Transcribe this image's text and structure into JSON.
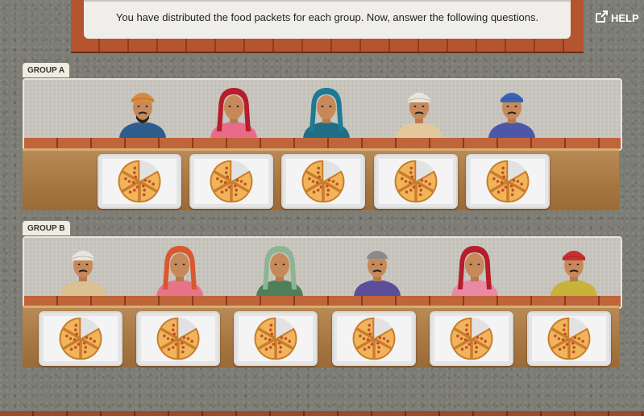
{
  "instruction": "You have distributed the food packets for each group. Now, answer the following questions.",
  "help_label": "HELP",
  "groups": [
    {
      "label": "GROUP A",
      "people": [
        {
          "shirt": "#2d5d8c",
          "head": "turban-orange",
          "beard": true
        },
        {
          "shirt": "#e86c8a",
          "head": "sari-red"
        },
        {
          "shirt": "#1f6e86",
          "head": "sari-teal"
        },
        {
          "shirt": "#e2c89a",
          "head": "turban-white"
        },
        {
          "shirt": "#4d57a8",
          "head": "turban-blue"
        }
      ],
      "plates": [
        {
          "food": "pizza-slices"
        },
        {
          "food": "pizza-slices"
        },
        {
          "food": "pizza-slices"
        },
        {
          "food": "pizza-slices"
        },
        {
          "food": "pizza-slices"
        }
      ]
    },
    {
      "label": "GROUP B",
      "people": [
        {
          "shirt": "#d9c192",
          "head": "turban-white"
        },
        {
          "shirt": "#e8748a",
          "head": "sari-orange"
        },
        {
          "shirt": "#4f7f5a",
          "head": "sari-green"
        },
        {
          "shirt": "#5c4e9a",
          "head": "cap-grey"
        },
        {
          "shirt": "#e88aa6",
          "head": "sari-red"
        },
        {
          "shirt": "#c7b23a",
          "head": "turban-red"
        }
      ],
      "plates": [
        {
          "food": "pizza-slices"
        },
        {
          "food": "pizza-slices"
        },
        {
          "food": "pizza-slices"
        },
        {
          "food": "pizza-slices"
        },
        {
          "food": "pizza-slices"
        },
        {
          "food": "pizza-slices"
        }
      ]
    }
  ]
}
